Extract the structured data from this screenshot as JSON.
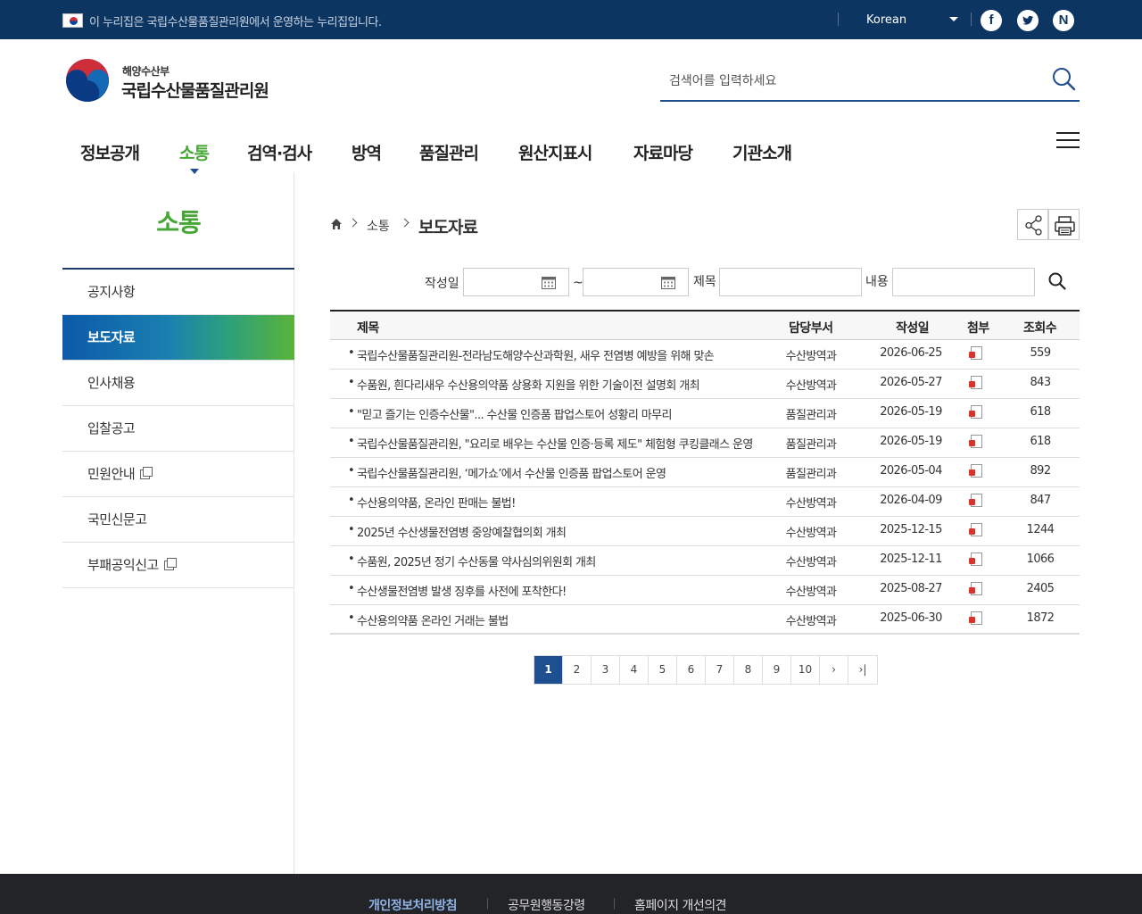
{
  "topbar": {
    "notice": "이 누리집은 국립수산물품질관리원에서 운영하는 누리집입니다.",
    "language": "Korean",
    "sns": [
      "f",
      "t",
      "N"
    ]
  },
  "header": {
    "logo_ministry": "해양수산부",
    "logo_org": "국립수산물품질관리원",
    "search_placeholder": "검색어를 입력하세요"
  },
  "gnb": {
    "items": [
      {
        "label": "정보공개"
      },
      {
        "label": "소통",
        "active": true
      },
      {
        "label": "검역·검사"
      },
      {
        "label": "방역"
      },
      {
        "label": "품질관리"
      },
      {
        "label": "원산지표시"
      },
      {
        "label": "자료마당"
      },
      {
        "label": "기관소개"
      }
    ]
  },
  "lnb": {
    "title": "소통",
    "items": [
      {
        "label": "공지사항"
      },
      {
        "label": "보도자료",
        "active": true
      },
      {
        "label": "인사채용"
      },
      {
        "label": "입찰공고"
      },
      {
        "label": "민원안내",
        "external": true
      },
      {
        "label": "국민신문고"
      },
      {
        "label": "부패공익신고",
        "external": true
      }
    ]
  },
  "breadcrumb": {
    "level1": "소통",
    "current": "보도자료"
  },
  "search_form": {
    "date_label": "작성일",
    "tilde": "~",
    "title_label": "제목",
    "content_label": "내용"
  },
  "table": {
    "headers": {
      "title": "제목",
      "dept": "담당부서",
      "date": "작성일",
      "file": "첨부",
      "views": "조회수"
    },
    "rows": [
      {
        "title": "국립수산물품질관리원-전라남도해양수산과학원, 새우 전염병 예방을 위해 맞손",
        "dept": "수산방역과",
        "date": "2026-06-25",
        "views": "559"
      },
      {
        "title": "수품원, 흰다리새우 수산용의약품 상용화 지원을 위한 기술이전 설명회 개최",
        "dept": "수산방역과",
        "date": "2026-05-27",
        "views": "843"
      },
      {
        "title": "\"믿고 즐기는 인증수산물\"... 수산물 인증품 팝업스토어 성황리 마무리",
        "dept": "품질관리과",
        "date": "2026-05-19",
        "views": "618"
      },
      {
        "title": "국립수산물품질관리원, \"요리로 배우는 수산물 인증·등록 제도\" 체험형 쿠킹클래스 운영",
        "dept": "품질관리과",
        "date": "2026-05-19",
        "views": "618"
      },
      {
        "title": "국립수산물품질관리원, ‘메가쇼’에서 수산물 인증품 팝업스토어 운영",
        "dept": "품질관리과",
        "date": "2026-05-04",
        "views": "892"
      },
      {
        "title": "수산용의약품, 온라인 판매는 불법!",
        "dept": "수산방역과",
        "date": "2026-04-09",
        "views": "847"
      },
      {
        "title": "2025년 수산생물전염병 중앙예찰협의회 개최",
        "dept": "수산방역과",
        "date": "2025-12-15",
        "views": "1244"
      },
      {
        "title": "수품원, 2025년 정기 수산동물 약사심의위원회 개최",
        "dept": "수산방역과",
        "date": "2025-12-11",
        "views": "1066"
      },
      {
        "title": "수산생물전염병 발생 징후를 사전에 포착한다!",
        "dept": "수산방역과",
        "date": "2025-08-27",
        "views": "2405"
      },
      {
        "title": "수산용의약품 온라인 거래는 불법",
        "dept": "수산방역과",
        "date": "2025-06-30",
        "views": "1872"
      }
    ]
  },
  "pagination": {
    "pages": [
      "1",
      "2",
      "3",
      "4",
      "5",
      "6",
      "7",
      "8",
      "9",
      "10"
    ],
    "current": "1",
    "next": "›",
    "last": "›|"
  },
  "footer": {
    "links": [
      "개인정보처리방침",
      "공무원행동강령",
      "홈페이지 개선의견"
    ]
  },
  "colors": {
    "topbar": "#0d3561",
    "accent_green": "#48a637",
    "accent_blue": "#1d4f91"
  }
}
